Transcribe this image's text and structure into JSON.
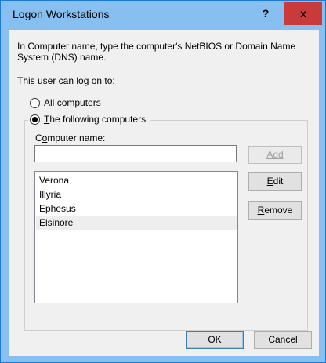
{
  "titlebar": {
    "title": "Logon Workstations",
    "help_label": "?",
    "close_label": "x"
  },
  "intro_text_line1": "In Computer name, type the computer's NetBIOS or Domain Name",
  "intro_text_line2": "System (DNS) name.",
  "logon_label": "This user can log on to:",
  "radio_all": {
    "label_u": "A",
    "label_rest": "ll ",
    "label_u2": "c",
    "label_rest2": "omputers",
    "selected": false
  },
  "radio_following": {
    "label_u": "T",
    "label_rest": "he following computers",
    "selected": true
  },
  "computer_name": {
    "label_pre": "C",
    "label_u": "o",
    "label_rest": "mputer name:",
    "value": ""
  },
  "buttons": {
    "add": "Add",
    "edit": "Edit",
    "remove": "Remove",
    "ok": "OK",
    "cancel": "Cancel"
  },
  "computers": [
    "Verona",
    "Illyria",
    "Ephesus",
    "Elsinore"
  ],
  "selected_index": 3,
  "colors": {
    "titlebar": "#86bff0",
    "close_button": "#c93a3a",
    "client": "#f0f0f0"
  }
}
